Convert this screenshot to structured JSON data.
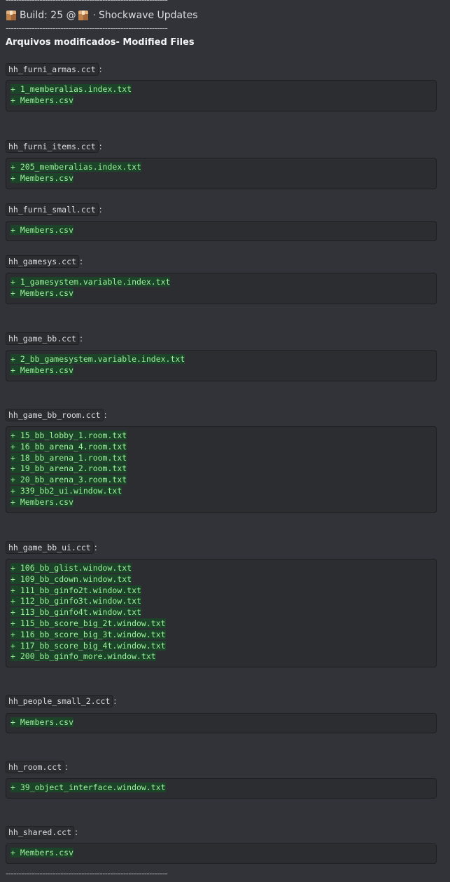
{
  "header": {
    "separator_top": "--------------------------------------------------------------",
    "build_label": "Build: 25 @",
    "middle_dot": "·",
    "channel": "Shockwave Updates",
    "separator_after_header": "--------------------------------------------------------------",
    "title": "Arquivos modificados- Modified Files",
    "separator_bottom": "--------------------------------------------------------------"
  },
  "sections": [
    {
      "name": "hh_furni_armas.cct",
      "files": [
        "+ 1_memberalias.index.txt",
        "+ Members.csv"
      ]
    },
    {
      "name": "hh_furni_items.cct",
      "files": [
        "+ 205_memberalias.index.txt",
        "+ Members.csv"
      ]
    },
    {
      "name": "hh_furni_small.cct",
      "files": [
        "+ Members.csv"
      ]
    },
    {
      "name": "hh_gamesys.cct",
      "files": [
        "+ 1_gamesystem.variable.index.txt",
        "+ Members.csv"
      ]
    },
    {
      "name": "hh_game_bb.cct",
      "files": [
        "+ 2_bb_gamesystem.variable.index.txt",
        "+ Members.csv"
      ]
    },
    {
      "name": "hh_game_bb_room.cct",
      "files": [
        "+ 15_bb_lobby_1.room.txt",
        "+ 16_bb_arena_4.room.txt",
        "+ 18_bb_arena_1.room.txt",
        "+ 19_bb_arena_2.room.txt",
        "+ 20_bb_arena_3.room.txt",
        "+ 339_bb2_ui.window.txt",
        "+ Members.csv"
      ]
    },
    {
      "name": "hh_game_bb_ui.cct",
      "files": [
        "+ 106_bb_glist.window.txt",
        "+ 109_bb_cdown.window.txt",
        "+ 111_bb_ginfo2t.window.txt",
        "+ 112_bb_ginfo3t.window.txt",
        "+ 113_bb_ginfo4t.window.txt",
        "+ 115_bb_score_big_2t.window.txt",
        "+ 116_bb_score_big_3t.window.txt",
        "+ 117_bb_score_big_4t.window.txt",
        "+ 200_bb_ginfo_more.window.txt"
      ]
    },
    {
      "name": "hh_people_small_2.cct",
      "files": [
        "+ Members.csv"
      ]
    },
    {
      "name": "hh_room.cct",
      "files": [
        "+ 39_object_interface.window.txt"
      ]
    },
    {
      "name": "hh_shared.cct",
      "files": [
        "+ Members.csv"
      ]
    }
  ]
}
